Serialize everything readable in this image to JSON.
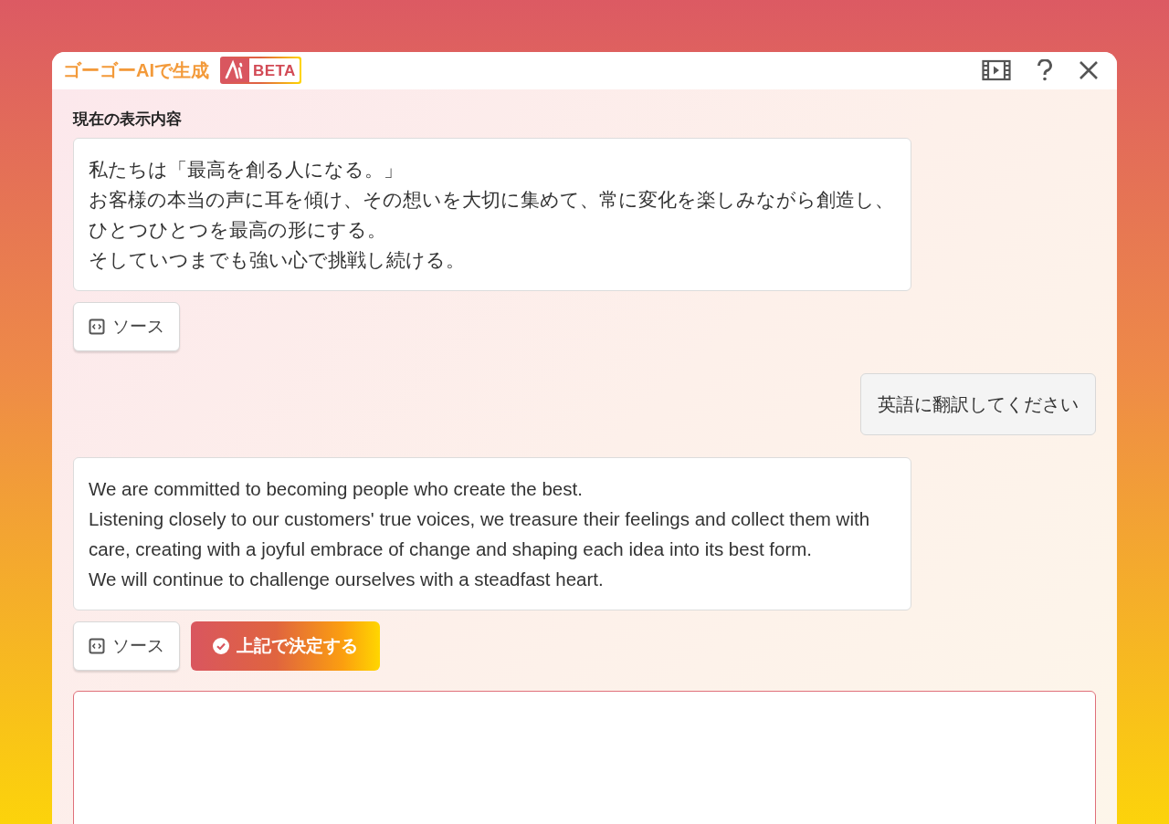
{
  "dialog": {
    "title": "ゴーゴーAIで生成",
    "badge": "BETA"
  },
  "current_label": "現在の表示内容",
  "messages": [
    {
      "kind": "assistant",
      "paragraphs": [
        "私たちは「最高を創る人になる。」",
        "お客様の本当の声に耳を傾け、その想いを大切に集めて、常に変化を楽しみながら創造し、ひとつひとつを最高の形にする。",
        "そしていつまでも強い心で挑戦し続ける。"
      ],
      "actions": [
        {
          "kind": "source",
          "label": "ソース"
        }
      ]
    },
    {
      "kind": "user",
      "text": "英語に翻訳してください"
    },
    {
      "kind": "assistant",
      "paragraphs": [
        "We are committed to becoming people who create the best.",
        "Listening closely to our customers' true voices, we treasure their feelings and collect them with care, creating with a joyful embrace of change and shaping each idea into its best form.",
        "We will continue to challenge ourselves with a steadfast heart."
      ],
      "actions": [
        {
          "kind": "source",
          "label": "ソース"
        },
        {
          "kind": "confirm",
          "label": "上記で決定する"
        }
      ]
    }
  ]
}
